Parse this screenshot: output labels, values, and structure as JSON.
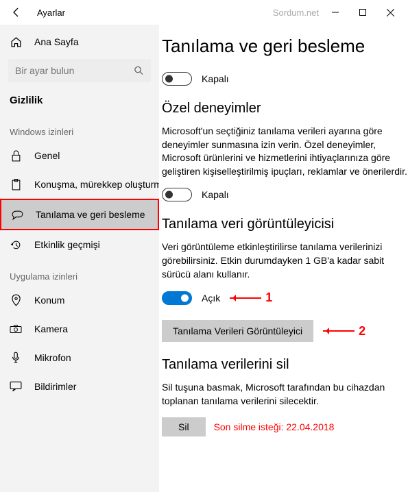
{
  "titlebar": {
    "title": "Ayarlar",
    "watermark": "Sordum.net"
  },
  "sidebar": {
    "home": "Ana Sayfa",
    "search_placeholder": "Bir ayar bulun",
    "category": "Gizlilik",
    "section_windows": "Windows izinleri",
    "section_apps": "Uygulama izinleri",
    "items_windows": {
      "genel": "Genel",
      "konusma": "Konuşma, mürekkep oluşturma",
      "tanilama": "Tanılama ve geri besleme",
      "etkinlik": "Etkinlik geçmişi"
    },
    "items_apps": {
      "konum": "Konum",
      "kamera": "Kamera",
      "mikrofon": "Mikrofon",
      "bildirimler": "Bildirimler"
    }
  },
  "main": {
    "title": "Tanılama ve geri besleme",
    "toggle_off": "Kapalı",
    "section_ozel": {
      "title": "Özel deneyimler",
      "body": "Microsoft'un seçtiğiniz tanılama verileri ayarına göre deneyimler sunmasına izin verin. Özel deneyimler, Microsoft ürünlerini ve hizmetlerini ihtiyaçlarınıza göre geliştiren kişiselleştirilmiş ipuçları, reklamlar ve önerilerdir."
    },
    "section_viewer": {
      "title": "Tanılama veri görüntüleyicisi",
      "body": "Veri görüntüleme etkinleştirilirse tanılama verilerinizi görebilirsiniz. Etkin durumdayken 1 GB'a kadar sabit sürücü alanı kullanır.",
      "toggle_on": "Açık",
      "button": "Tanılama Verileri Görüntüleyici"
    },
    "section_delete": {
      "title": "Tanılama verilerini sil",
      "body": "Sil tuşuna basmak, Microsoft tarafından bu cihazdan toplanan tanılama verilerini silecektir.",
      "button": "Sil",
      "last_request": "Son silme isteği: 22.04.2018"
    },
    "annotations": {
      "one": "1",
      "two": "2"
    }
  }
}
